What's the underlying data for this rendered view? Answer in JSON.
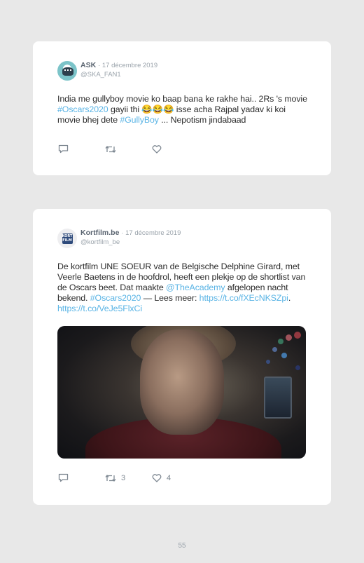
{
  "tweets": [
    {
      "author": "ASK",
      "date": "· 17 décembre 2019",
      "handle": "@SKA_FAN1",
      "text": {
        "p1": "India me gullyboy movie ko baap bana ke rakhe hai.. 2Rs 's movie ",
        "h1": "#Oscars2020",
        "p2": " gayii thi 😂😂😂 isse acha Rajpal yadav ki koi movie bhej dete ",
        "h2": "#GullyBoy",
        "p3": " ... Nepotism jindabaad"
      },
      "retweet_count": "",
      "like_count": ""
    },
    {
      "author": "Kortfilm.be",
      "date": "· 17 décembre 2019",
      "handle": "@kortfilm_be",
      "avatar_text": "KORT FILM",
      "text": {
        "p1": "De kortfilm UNE SOEUR van de Belgische Delphine Girard, met Veerle Baetens in de hoofdrol, heeft een plekje op de shortlist van de Oscars beet. Dat maakte ",
        "m1": "@TheAcademy",
        "p2": " afgelopen nacht bekend. ",
        "h1": "#Oscars2020",
        "p3": " — Lees meer: ",
        "l1": "https://t.co/fXEcNKSZpi",
        "p4": ". ",
        "l2": "https://t.co/VeJe5FlxCi"
      },
      "retweet_count": "3",
      "like_count": "4"
    }
  ],
  "page_number": "55",
  "colors": {
    "background": "#e8e8e8",
    "card": "#ffffff",
    "link": "#5ab4e5",
    "icon": "#7d8791"
  },
  "icons": [
    "reply-icon",
    "retweet-icon",
    "heart-icon"
  ]
}
